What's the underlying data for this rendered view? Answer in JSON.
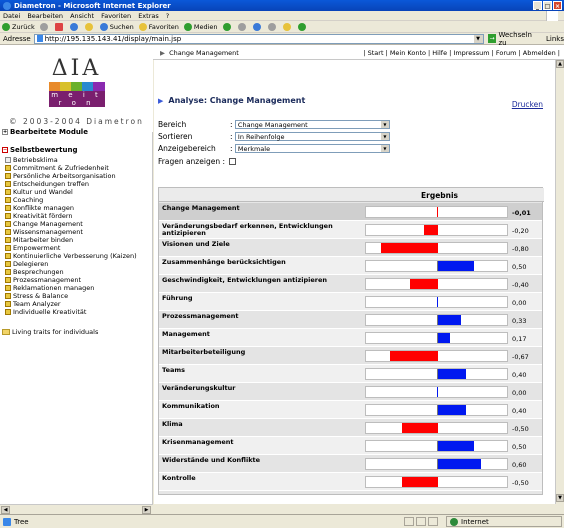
{
  "window": {
    "title": "Diametron - Microsoft Internet Explorer"
  },
  "menu": [
    "Datei",
    "Bearbeiten",
    "Ansicht",
    "Favoriten",
    "Extras",
    "?"
  ],
  "toolbar": {
    "back": "Zurück",
    "search": "Suchen",
    "favorites": "Favoriten",
    "media": "Medien"
  },
  "address": {
    "label": "Adresse",
    "url": "http://195.135.143.41/display/main.jsp",
    "go": "Wechseln zu",
    "links": "Links"
  },
  "logo": {
    "greek": "ΔΙΑ",
    "brand": "m e i t r o n",
    "copyright": "© 2003-2004 Diametron"
  },
  "nav": {
    "section1": "Bearbeitete Module",
    "section2": "Selbstbewertung",
    "items": [
      "Betriebsklima",
      "Commitment & Zufriedenheit",
      "Persönliche Arbeitsorganisation",
      "Entscheidungen treffen",
      "Kultur und Wandel",
      "Coaching",
      "Konflikte managen",
      "Kreativität fördern",
      "Change Management",
      "Wissensmanagement",
      "Mitarbeiter binden",
      "Empowerment",
      "Kontinuierliche Verbesserung (Kaizen)",
      "Delegieren",
      "Besprechungen",
      "Prozessmanagement",
      "Reklamationen managen",
      "Stress & Balance",
      "Team Analyzer",
      "Individuelle Kreativität"
    ],
    "folder": "Living traits for individuals"
  },
  "topbar": {
    "breadcrumb": "Change Management",
    "links": "| Start | Mein Konto | Hilfe | Impressum | Forum | Abmelden |"
  },
  "main": {
    "heading": "Analyse: Change Management",
    "print": "Drucken",
    "form": {
      "bereich_label": "Bereich",
      "bereich_value": "Change Management",
      "sortieren_label": "Sortieren",
      "sortieren_value": "In Reihenfolge",
      "anzeige_label": "Anzeigebereich",
      "anzeige_value": "Merkmale",
      "fragen_label": "Fragen anzeigen :"
    },
    "results_header": "Ergebnis"
  },
  "chart_data": {
    "type": "bar",
    "xlim": [
      -1,
      1
    ],
    "rows": [
      {
        "label": "Change Management",
        "value": -0.01,
        "display": "-0,01"
      },
      {
        "label": "Veränderungsbedarf erkennen, Entwicklungen antizipieren",
        "value": -0.2,
        "display": "-0,20"
      },
      {
        "label": "Visionen und Ziele",
        "value": -0.8,
        "display": "-0,80"
      },
      {
        "label": "Zusammenhänge berücksichtigen",
        "value": 0.5,
        "display": "0,50"
      },
      {
        "label": "Geschwindigkeit, Entwicklungen antizipieren",
        "value": -0.4,
        "display": "-0,40"
      },
      {
        "label": "Führung",
        "value": 0.0,
        "display": "0,00"
      },
      {
        "label": "Prozessmanagement",
        "value": 0.33,
        "display": "0,33"
      },
      {
        "label": "Management",
        "value": 0.17,
        "display": "0,17"
      },
      {
        "label": "Mitarbeiterbeteiligung",
        "value": -0.67,
        "display": "-0,67"
      },
      {
        "label": "Teams",
        "value": 0.4,
        "display": "0,40"
      },
      {
        "label": "Veränderungskultur",
        "value": 0.0,
        "display": "0,00"
      },
      {
        "label": "Kommunikation",
        "value": 0.4,
        "display": "0,40"
      },
      {
        "label": "Klima",
        "value": -0.5,
        "display": "-0,50"
      },
      {
        "label": "Krisenmanagement",
        "value": 0.5,
        "display": "0,50"
      },
      {
        "label": "Widerstände und Konflikte",
        "value": 0.6,
        "display": "0,60"
      },
      {
        "label": "Kontrolle",
        "value": -0.5,
        "display": "-0,50"
      }
    ],
    "colors": {
      "negative": "#ff0000",
      "positive": "#0018f0"
    }
  },
  "status": {
    "left": "Tree",
    "zone": "Internet"
  }
}
